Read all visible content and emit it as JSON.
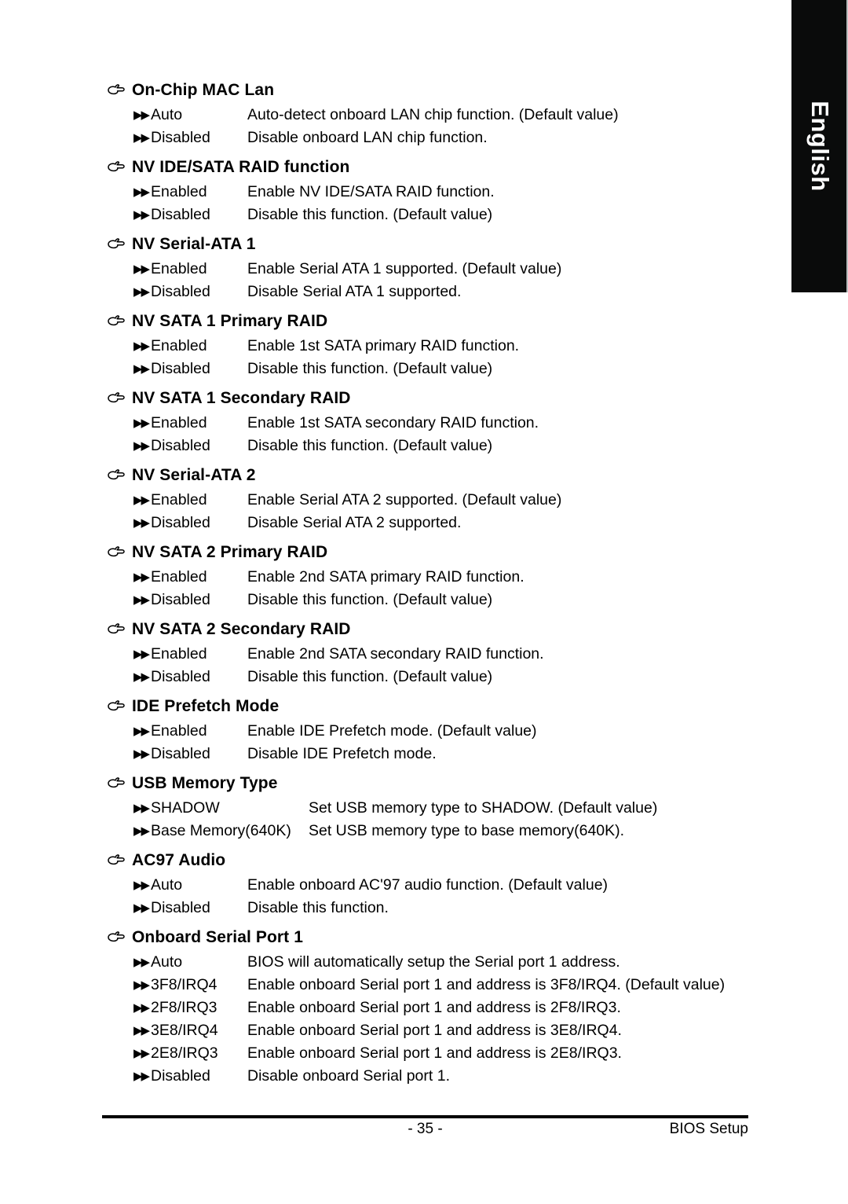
{
  "language_tab": {
    "label": "English"
  },
  "icons": {
    "heading_pointer": "pointing-hand-icon",
    "option_bullet": "double-right-arrow-icon",
    "bullet_glyph": "▶▶"
  },
  "settings": [
    {
      "title": "On-Chip MAC Lan",
      "wide": false,
      "options": [
        {
          "name": "Auto",
          "desc": "Auto-detect onboard LAN chip function. (Default value)"
        },
        {
          "name": "Disabled",
          "desc": "Disable onboard LAN chip function."
        }
      ]
    },
    {
      "title": "NV IDE/SATA RAID function",
      "wide": false,
      "options": [
        {
          "name": "Enabled",
          "desc": "Enable NV IDE/SATA RAID function."
        },
        {
          "name": "Disabled",
          "desc": "Disable this function. (Default value)"
        }
      ]
    },
    {
      "title": "NV Serial-ATA 1",
      "wide": false,
      "options": [
        {
          "name": "Enabled",
          "desc": "Enable Serial ATA 1 supported. (Default value)"
        },
        {
          "name": "Disabled",
          "desc": "Disable Serial ATA 1 supported."
        }
      ]
    },
    {
      "title": "NV SATA 1 Primary RAID",
      "wide": false,
      "options": [
        {
          "name": "Enabled",
          "desc": "Enable 1st SATA primary RAID function."
        },
        {
          "name": "Disabled",
          "desc": "Disable this function. (Default value)"
        }
      ]
    },
    {
      "title": "NV SATA 1 Secondary RAID",
      "wide": false,
      "options": [
        {
          "name": "Enabled",
          "desc": "Enable 1st SATA secondary RAID function."
        },
        {
          "name": "Disabled",
          "desc": "Disable this function. (Default value)"
        }
      ]
    },
    {
      "title": "NV Serial-ATA 2",
      "wide": false,
      "options": [
        {
          "name": "Enabled",
          "desc": "Enable Serial ATA 2 supported. (Default value)"
        },
        {
          "name": "Disabled",
          "desc": "Disable Serial ATA 2 supported."
        }
      ]
    },
    {
      "title": "NV SATA 2 Primary RAID",
      "wide": false,
      "options": [
        {
          "name": "Enabled",
          "desc": "Enable 2nd SATA primary RAID function."
        },
        {
          "name": "Disabled",
          "desc": "Disable this function. (Default value)"
        }
      ]
    },
    {
      "title": "NV SATA 2 Secondary RAID",
      "wide": false,
      "options": [
        {
          "name": "Enabled",
          "desc": "Enable 2nd SATA secondary RAID function."
        },
        {
          "name": "Disabled",
          "desc": "Disable this function. (Default value)"
        }
      ]
    },
    {
      "title": "IDE Prefetch Mode",
      "wide": false,
      "options": [
        {
          "name": "Enabled",
          "desc": "Enable IDE Prefetch mode. (Default value)"
        },
        {
          "name": "Disabled",
          "desc": "Disable IDE Prefetch mode."
        }
      ]
    },
    {
      "title": "USB Memory Type",
      "wide": true,
      "options": [
        {
          "name": "SHADOW",
          "desc": "Set USB memory type to SHADOW. (Default value)"
        },
        {
          "name": "Base Memory(640K)",
          "desc": "Set USB memory type to base memory(640K)."
        }
      ]
    },
    {
      "title": "AC97 Audio",
      "wide": false,
      "options": [
        {
          "name": "Auto",
          "desc": "Enable onboard AC'97 audio function. (Default value)"
        },
        {
          "name": "Disabled",
          "desc": "Disable this function."
        }
      ]
    },
    {
      "title": "Onboard Serial Port 1",
      "wide": false,
      "options": [
        {
          "name": "Auto",
          "desc": "BIOS will automatically setup the Serial port 1 address."
        },
        {
          "name": "3F8/IRQ4",
          "desc": "Enable onboard Serial port 1 and address is 3F8/IRQ4. (Default value)"
        },
        {
          "name": "2F8/IRQ3",
          "desc": "Enable onboard Serial port 1 and address is 2F8/IRQ3."
        },
        {
          "name": "3E8/IRQ4",
          "desc": "Enable onboard Serial port 1 and address is 3E8/IRQ4."
        },
        {
          "name": "2E8/IRQ3",
          "desc": "Enable onboard Serial port 1 and address is 2E8/IRQ3."
        },
        {
          "name": "Disabled",
          "desc": "Disable onboard Serial port 1."
        }
      ]
    }
  ],
  "footer": {
    "page_number": "- 35 -",
    "section": "BIOS Setup"
  }
}
